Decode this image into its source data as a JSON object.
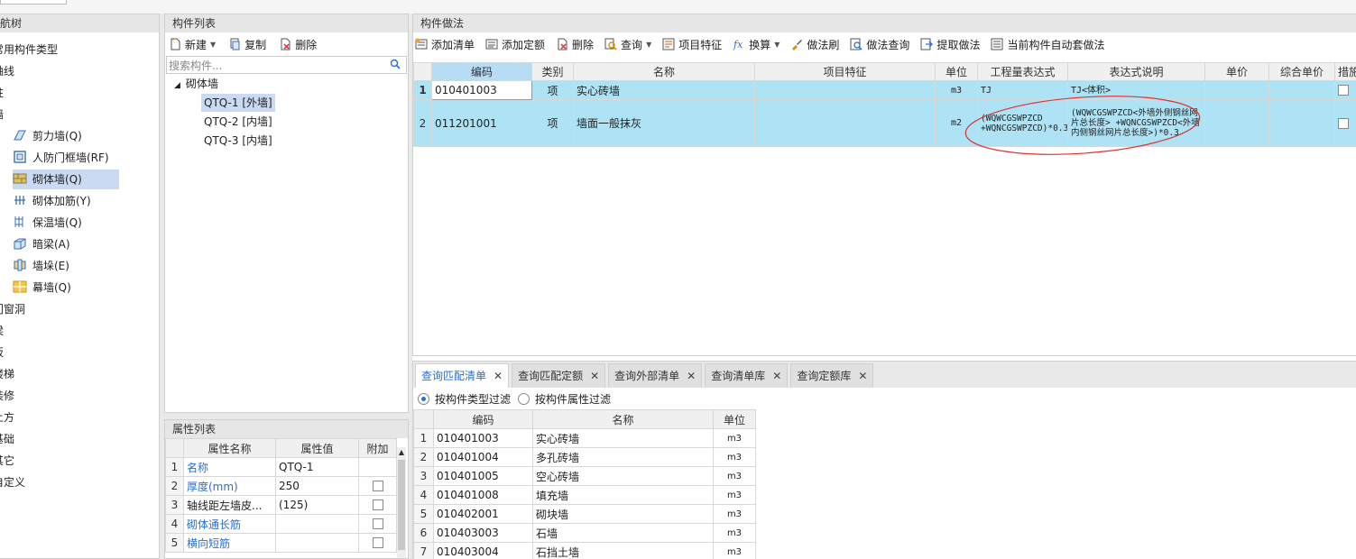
{
  "tree": {
    "header": "构件导航树",
    "items": [
      {
        "label": "常用构件类型",
        "level": 0
      },
      {
        "label": "轴线",
        "level": 0
      },
      {
        "label": "柱",
        "level": 0
      },
      {
        "label": "墙",
        "level": 0
      },
      {
        "label": "剪力墙(Q)",
        "level": 1,
        "icon": "shear-wall-icon"
      },
      {
        "label": "人防门框墙(RF)",
        "level": 1,
        "icon": "door-frame-wall-icon"
      },
      {
        "label": "砌体墙(Q)",
        "level": 1,
        "icon": "masonry-wall-icon",
        "selected": true
      },
      {
        "label": "砌体加筋(Y)",
        "level": 1,
        "icon": "masonry-rebar-icon"
      },
      {
        "label": "保温墙(Q)",
        "level": 1,
        "icon": "insulation-wall-icon"
      },
      {
        "label": "暗梁(A)",
        "level": 1,
        "icon": "hidden-beam-icon"
      },
      {
        "label": "墙垛(E)",
        "level": 1,
        "icon": "wall-pier-icon"
      },
      {
        "label": "幕墙(Q)",
        "level": 1,
        "icon": "curtain-wall-icon"
      },
      {
        "label": "门窗洞",
        "level": 0
      },
      {
        "label": "梁",
        "level": 0
      },
      {
        "label": "板",
        "level": 0
      },
      {
        "label": "楼梯",
        "level": 0
      },
      {
        "label": "装修",
        "level": 0
      },
      {
        "label": "土方",
        "level": 0
      },
      {
        "label": "基础",
        "level": 0
      },
      {
        "label": "其它",
        "level": 0
      },
      {
        "label": "自定义",
        "level": 0
      }
    ]
  },
  "components": {
    "header": "构件列表",
    "toolbar": {
      "new": "新建",
      "copy": "复制",
      "delete": "删除"
    },
    "search_placeholder": "搜索构件...",
    "group": "砌体墙",
    "items": [
      {
        "label": "QTQ-1 [外墙]",
        "selected": true
      },
      {
        "label": "QTQ-2 [内墙]"
      },
      {
        "label": "QTQ-3 [内墙]"
      }
    ]
  },
  "attributes": {
    "header": "属性列表",
    "columns": [
      "属性名称",
      "属性值",
      "附加"
    ],
    "rows": [
      {
        "n": "1",
        "name": "名称",
        "value": "QTQ-1",
        "blue": true,
        "check": false
      },
      {
        "n": "2",
        "name": "厚度(mm)",
        "value": "250",
        "blue": true,
        "check": true
      },
      {
        "n": "3",
        "name": "轴线距左墙皮...",
        "value": "(125)",
        "blue": false,
        "check": true
      },
      {
        "n": "4",
        "name": "砌体通长筋",
        "value": "",
        "blue": true,
        "check": true
      },
      {
        "n": "5",
        "name": "横向短筋",
        "value": "",
        "blue": true,
        "check": true
      }
    ]
  },
  "method": {
    "header": "构件做法",
    "toolbar": [
      "添加清单",
      "添加定额",
      "删除",
      "查询",
      "项目特征",
      "换算",
      "做法刷",
      "做法查询",
      "提取做法",
      "当前构件自动套做法"
    ],
    "columns": [
      "编码",
      "类别",
      "名称",
      "项目特征",
      "单位",
      "工程量表达式",
      "表达式说明",
      "单价",
      "综合单价",
      "措施"
    ],
    "rows": [
      {
        "n": "1",
        "code": "010401003",
        "type": "项",
        "name": "实心砖墙",
        "feature": "",
        "unit": "m3",
        "expr": "TJ",
        "desc": "TJ<体积>",
        "price": "",
        "total": ""
      },
      {
        "n": "2",
        "code": "011201001",
        "type": "项",
        "name": "墙面一般抹灰",
        "feature": "",
        "unit": "m2",
        "expr": "(WQWCGSWPZCD +WQNCGSWPZCD)*0.3",
        "desc": "(WQWCGSWPZCD<外墙外侧钢丝网片总长度> +WQNCGSWPZCD<外墙内侧钢丝网片总长度>)*0.3",
        "price": "",
        "total": ""
      }
    ]
  },
  "query": {
    "tabs": [
      "查询匹配清单",
      "查询匹配定额",
      "查询外部清单",
      "查询清单库",
      "查询定额库"
    ],
    "filters": [
      "按构件类型过滤",
      "按构件属性过滤"
    ],
    "columns": [
      "编码",
      "名称",
      "单位"
    ],
    "rows": [
      {
        "n": "1",
        "code": "010401003",
        "name": "实心砖墙",
        "unit": "m3"
      },
      {
        "n": "2",
        "code": "010401004",
        "name": "多孔砖墙",
        "unit": "m3"
      },
      {
        "n": "3",
        "code": "010401005",
        "name": "空心砖墙",
        "unit": "m3"
      },
      {
        "n": "4",
        "code": "010401008",
        "name": "填充墙",
        "unit": "m3"
      },
      {
        "n": "5",
        "code": "010402001",
        "name": "砌块墙",
        "unit": "m3"
      },
      {
        "n": "6",
        "code": "010403003",
        "name": "石墙",
        "unit": "m3"
      },
      {
        "n": "7",
        "code": "010403004",
        "name": "石挡土墙",
        "unit": "m3"
      }
    ]
  },
  "colors": {
    "accent": "#2a6fd1",
    "row_highlight": "#aee3f5",
    "selection": "#c9daf2",
    "annotation": "#e03030"
  }
}
